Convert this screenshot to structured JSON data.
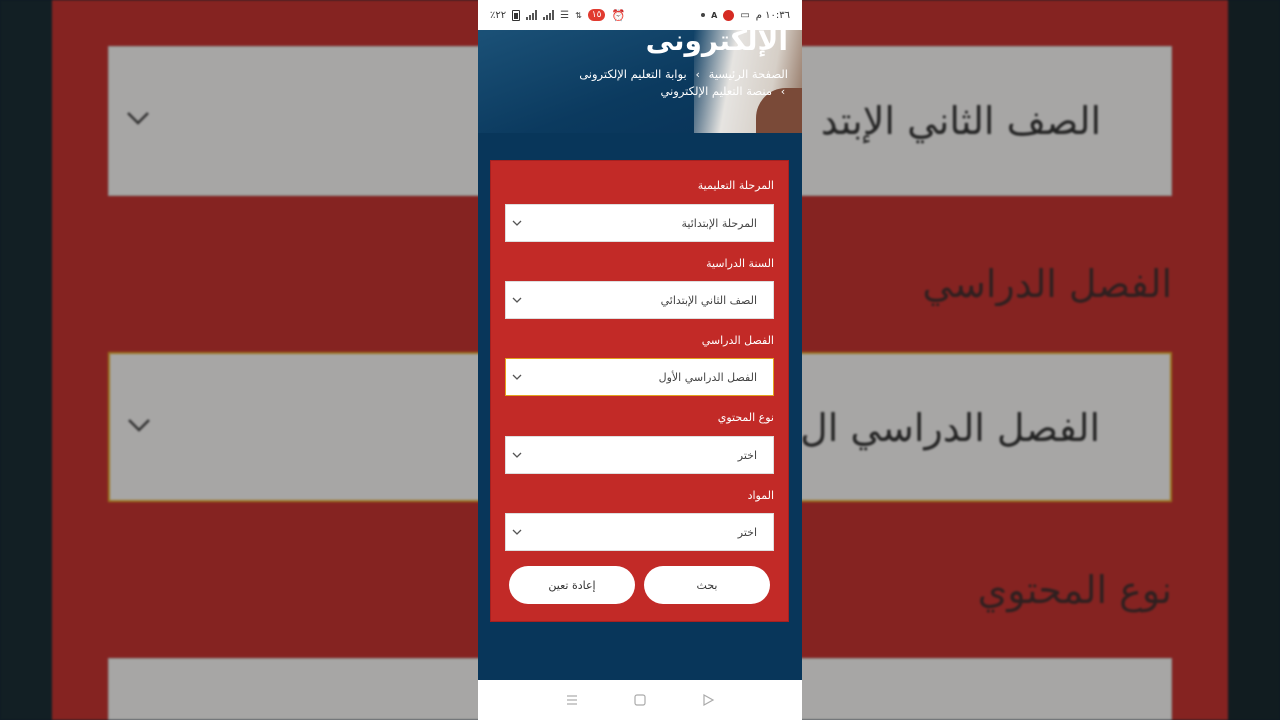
{
  "status_bar": {
    "battery": "٪٢٢",
    "time": "١٠:٣٦ م",
    "badge": "١٥"
  },
  "header": {
    "title": "الإلكترونى",
    "breadcrumbs": [
      "الصفحة الرئيسية",
      "بوابة التعليم الإلكترونى",
      "منصة التعليم الإلكتروني"
    ]
  },
  "form": {
    "fields": [
      {
        "label": "المرحلة التعليمية",
        "value": "المرحلة الإبتدائية"
      },
      {
        "label": "السنة الدراسية",
        "value": "الصف الثاني الإبتدائي"
      },
      {
        "label": "الفصل الدراسي",
        "value": "الفصل الدراسي الأول"
      },
      {
        "label": "نوع المحتوي",
        "value": "اختر"
      },
      {
        "label": "المواد",
        "value": "اختر"
      }
    ],
    "search_label": "بحث",
    "reset_label": "إعادة تعين"
  },
  "background": {
    "box1_text": "الصف الثاني الإبتد",
    "label1": "الفصل الدراسي",
    "box2_text": "الفصل الدراسي ال",
    "label2": "نوع المحتوي"
  },
  "colors": {
    "form_red": "#c22a27",
    "page_blue": "#08365a",
    "focus_border": "#e3a320"
  }
}
